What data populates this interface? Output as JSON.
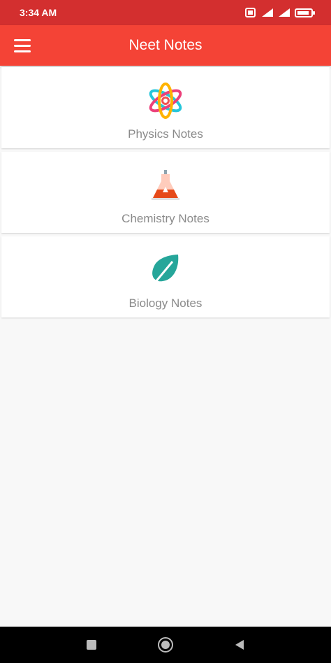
{
  "status_bar": {
    "time": "3:34 AM",
    "icons": [
      "notification-icon",
      "signal-icon",
      "signal-icon",
      "battery-icon"
    ]
  },
  "app_bar": {
    "title": "Neet Notes",
    "menu_icon": "hamburger-menu-icon"
  },
  "items": [
    {
      "label": "Physics Notes",
      "icon": "atom-icon"
    },
    {
      "label": "Chemistry Notes",
      "icon": "flask-icon"
    },
    {
      "label": "Biology Notes",
      "icon": "leaf-icon"
    }
  ],
  "nav_bar": {
    "icons": [
      "recent-apps-icon",
      "home-icon",
      "back-icon"
    ]
  },
  "colors": {
    "status_bar": "#d32f2f",
    "app_bar": "#f44336",
    "background": "#f8f8f8",
    "label_text": "#8a8a8a",
    "leaf": "#26a69a"
  }
}
